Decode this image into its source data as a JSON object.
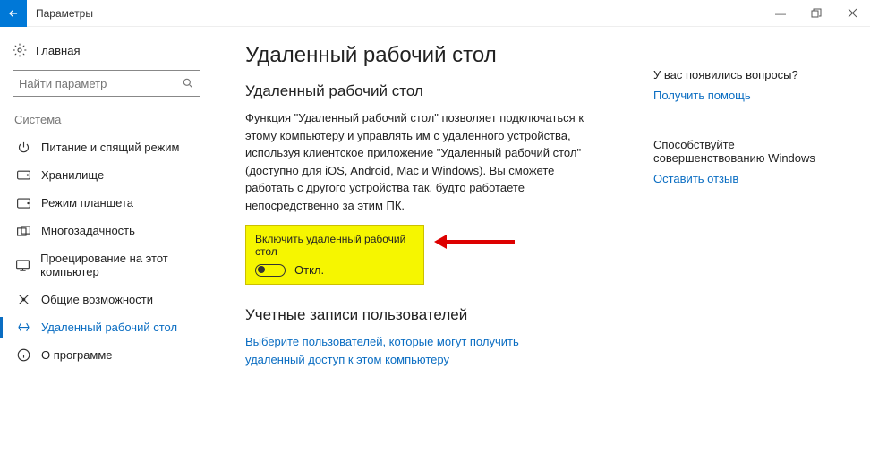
{
  "titlebar": {
    "title": "Параметры"
  },
  "sidebar": {
    "home": "Главная",
    "search_placeholder": "Найти параметр",
    "section": "Система",
    "items": [
      {
        "label": "Питание и спящий режим"
      },
      {
        "label": "Хранилище"
      },
      {
        "label": "Режим планшета"
      },
      {
        "label": "Многозадачность"
      },
      {
        "label": "Проецирование на этот компьютер"
      },
      {
        "label": "Общие возможности"
      },
      {
        "label": "Удаленный рабочий стол"
      },
      {
        "label": "О программе"
      }
    ]
  },
  "main": {
    "h1": "Удаленный рабочий стол",
    "h2": "Удаленный рабочий стол",
    "desc": "Функция \"Удаленный рабочий стол\" позволяет подключаться к этому компьютеру и управлять им с удаленного устройства, используя клиентское приложение \"Удаленный рабочий стол\" (доступно для iOS, Android, Mac и Windows). Вы сможете работать с другого устройства так, будто работаете непосредственно за этим ПК.",
    "toggle_label": "Включить удаленный рабочий стол",
    "toggle_state": "Откл.",
    "accounts_h": "Учетные записи пользователей",
    "accounts_link": "Выберите пользователей, которые могут получить удаленный доступ к этом компьютеру"
  },
  "right": {
    "q1": "У вас появились вопросы?",
    "help_link": "Получить помощь",
    "q2": "Способствуйте совершенствованию Windows",
    "feedback_link": "Оставить отзыв"
  }
}
